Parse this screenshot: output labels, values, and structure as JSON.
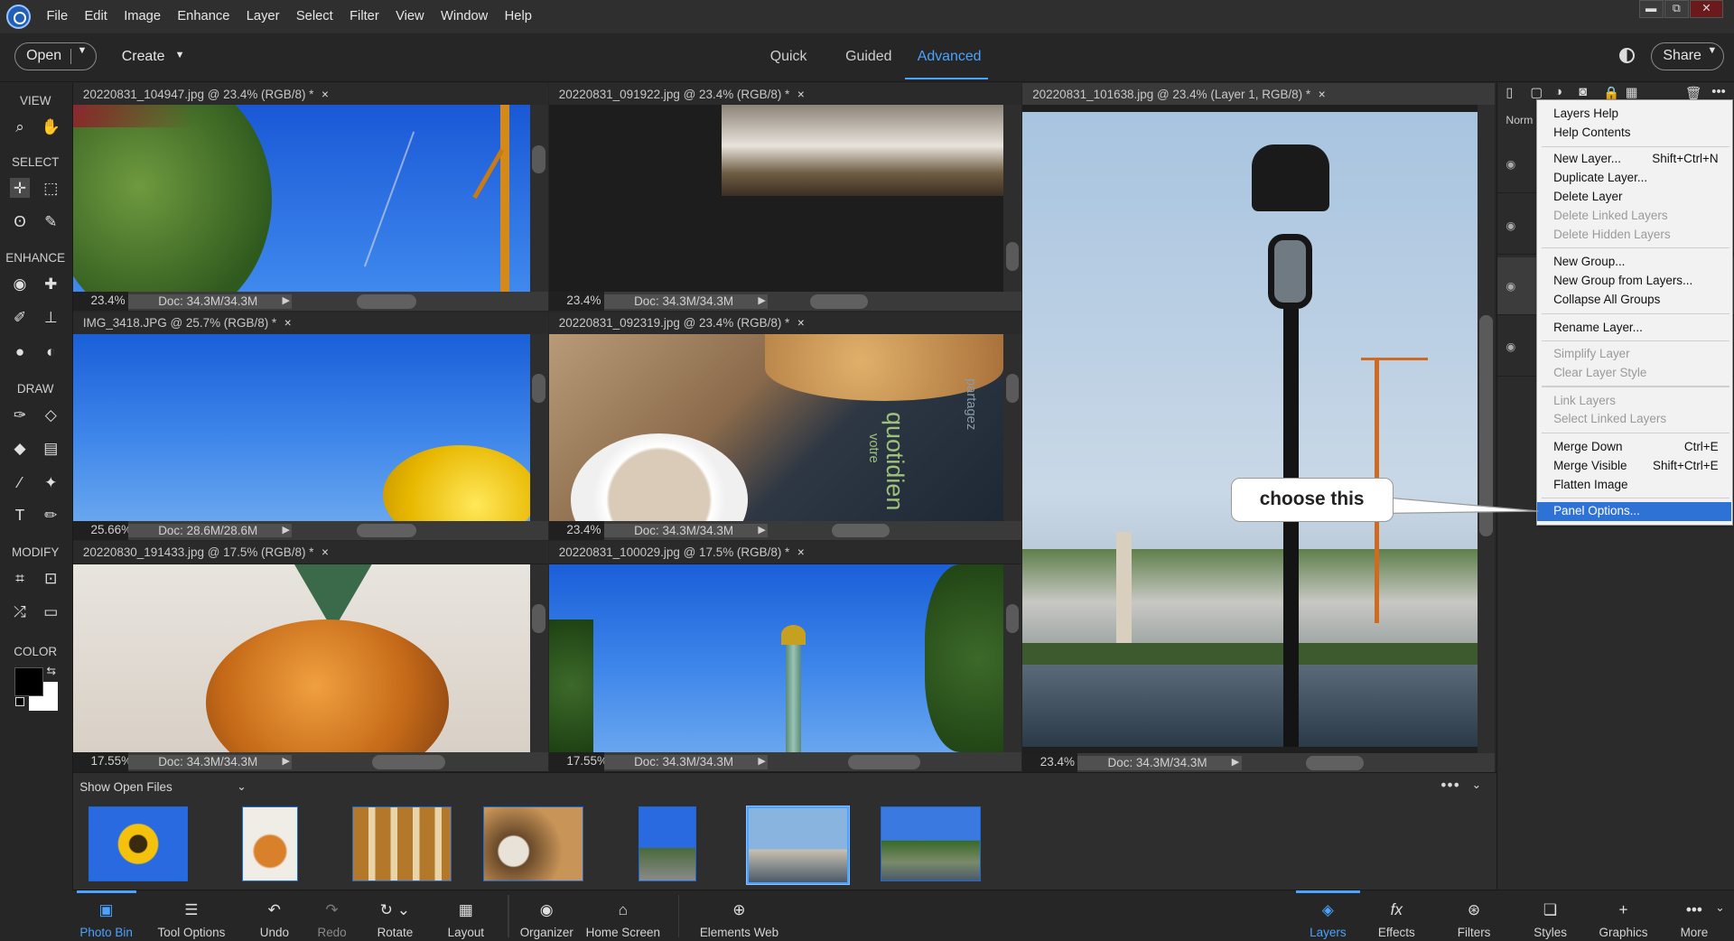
{
  "menubar": {
    "items": [
      "File",
      "Edit",
      "Image",
      "Enhance",
      "Layer",
      "Select",
      "Filter",
      "View",
      "Window",
      "Help"
    ],
    "window_controls": [
      "▬",
      "⧉",
      "✕"
    ]
  },
  "topbar": {
    "open": "Open",
    "create": "Create",
    "modes": [
      "Quick",
      "Guided",
      "Advanced"
    ],
    "active_mode": "Advanced",
    "share": "Share"
  },
  "toolbox": {
    "sections": [
      "VIEW",
      "SELECT",
      "ENHANCE",
      "DRAW",
      "MODIFY",
      "COLOR"
    ]
  },
  "documents": [
    {
      "tab": "20220831_104947.jpg @ 23.4% (RGB/8) *",
      "zoom": "23.4%",
      "size": "Doc: 34.3M/34.3M"
    },
    {
      "tab": "20220831_091922.jpg @ 23.4% (RGB/8) *",
      "zoom": "23.4%",
      "size": "Doc: 34.3M/34.3M"
    },
    {
      "tab": "20220831_101638.jpg @ 23.4% (Layer 1, RGB/8) *",
      "zoom": "23.4%",
      "size": "Doc: 34.3M/34.3M"
    },
    {
      "tab": "IMG_3418.JPG @ 25.7% (RGB/8) *",
      "zoom": "25.66%",
      "size": "Doc: 28.6M/28.6M"
    },
    {
      "tab": "20220831_092319.jpg @ 23.4% (RGB/8) *",
      "zoom": "23.4%",
      "size": "Doc: 34.3M/34.3M"
    },
    {
      "tab": "20220830_191433.jpg @ 17.5% (RGB/8) *",
      "zoom": "17.55%",
      "size": "Doc: 34.3M/34.3M"
    },
    {
      "tab": "20220831_100029.jpg @ 17.5% (RGB/8) *",
      "zoom": "17.55%",
      "size": "Doc: 34.3M/34.3M"
    }
  ],
  "close_glyph": "×",
  "image_text": {
    "paper_brand": "quotidien",
    "paper_word1": "votre",
    "paper_word2": "partagez"
  },
  "photo_bin": {
    "label": "Show Open Files",
    "thumbnails": [
      "sunflower",
      "pastry",
      "bakery-display",
      "coffee-table",
      "column-street",
      "lamp-post",
      "city-river"
    ]
  },
  "layers_panel": {
    "blend_mode": "Norm"
  },
  "context_menu": {
    "groups": [
      [
        {
          "label": "Layers Help"
        },
        {
          "label": "Help Contents"
        }
      ],
      [
        {
          "label": "New Layer...",
          "shortcut": "Shift+Ctrl+N"
        },
        {
          "label": "Duplicate Layer..."
        },
        {
          "label": "Delete Layer"
        },
        {
          "label": "Delete Linked Layers",
          "disabled": true
        },
        {
          "label": "Delete Hidden Layers",
          "disabled": true
        }
      ],
      [
        {
          "label": "New Group..."
        },
        {
          "label": "New Group from Layers..."
        },
        {
          "label": "Collapse All Groups"
        }
      ],
      [
        {
          "label": "Rename Layer..."
        }
      ],
      [
        {
          "label": "Simplify Layer",
          "disabled": true
        },
        {
          "label": "Clear Layer Style",
          "disabled": true
        }
      ],
      [
        {
          "label": "Link Layers",
          "disabled": true
        },
        {
          "label": "Select Linked Layers",
          "disabled": true
        }
      ],
      [
        {
          "label": "Merge Down",
          "shortcut": "Ctrl+E"
        },
        {
          "label": "Merge Visible",
          "shortcut": "Shift+Ctrl+E"
        },
        {
          "label": "Flatten Image"
        }
      ],
      [
        {
          "label": "Panel Options...",
          "highlighted": true
        }
      ]
    ]
  },
  "callout": "choose this",
  "bottombar": {
    "items": [
      {
        "label": "Photo Bin",
        "icon": "photo-bin-icon",
        "glyph": "▣",
        "active": true
      },
      {
        "label": "Tool Options",
        "icon": "tool-options-icon",
        "glyph": "☰"
      },
      {
        "label": "Undo",
        "icon": "undo-icon",
        "glyph": "↶"
      },
      {
        "label": "Redo",
        "icon": "redo-icon",
        "glyph": "↷"
      },
      {
        "label": "Rotate",
        "icon": "rotate-icon",
        "glyph": "↻ ⌄"
      },
      {
        "label": "Layout",
        "icon": "layout-icon",
        "glyph": "▦"
      },
      {
        "label": "Organizer",
        "icon": "organizer-icon",
        "glyph": "◉"
      },
      {
        "label": "Home Screen",
        "icon": "home-icon",
        "glyph": "⌂"
      },
      {
        "label": "Elements Web",
        "icon": "globe-icon",
        "glyph": "⊕"
      },
      {
        "label": "Layers",
        "icon": "layers-icon",
        "glyph": "◈",
        "active": true
      },
      {
        "label": "Effects",
        "icon": "effects-icon",
        "glyph": "fx"
      },
      {
        "label": "Filters",
        "icon": "filters-icon",
        "glyph": "⊛"
      },
      {
        "label": "Styles",
        "icon": "styles-icon",
        "glyph": "❏"
      },
      {
        "label": "Graphics",
        "icon": "graphics-icon",
        "glyph": "+"
      },
      {
        "label": "More",
        "icon": "more-icon",
        "glyph": "•••"
      }
    ]
  },
  "colors": {
    "accent": "#4aa3ff",
    "highlight": "#2f72d6"
  }
}
